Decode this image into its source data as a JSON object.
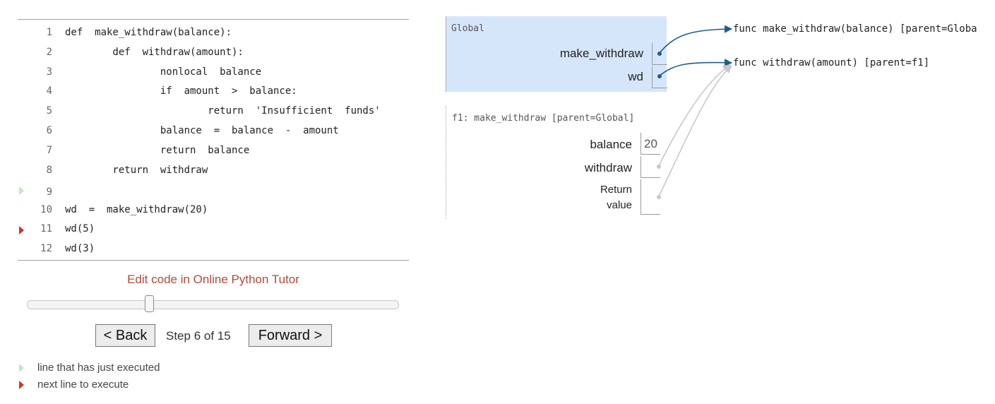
{
  "code": {
    "lines": [
      {
        "no": "1",
        "text": "def  make_withdraw(balance):",
        "marker": ""
      },
      {
        "no": "2",
        "text": "        def  withdraw(amount):",
        "marker": ""
      },
      {
        "no": "3",
        "text": "                nonlocal  balance",
        "marker": ""
      },
      {
        "no": "4",
        "text": "                if  amount  >  balance:",
        "marker": ""
      },
      {
        "no": "5",
        "text": "                        return  'Insufficient  funds'",
        "marker": ""
      },
      {
        "no": "6",
        "text": "                balance  =  balance  -  amount",
        "marker": ""
      },
      {
        "no": "7",
        "text": "                return  balance",
        "marker": ""
      },
      {
        "no": "8",
        "text": "        return  withdraw",
        "marker": ""
      },
      {
        "no": "9",
        "text": "",
        "marker": "green"
      },
      {
        "no": "10",
        "text": "wd  =  make_withdraw(20)",
        "marker": ""
      },
      {
        "no": "11",
        "text": "wd(5)",
        "marker": "red"
      },
      {
        "no": "12",
        "text": "wd(3)",
        "marker": ""
      }
    ]
  },
  "controls": {
    "edit_link": "Edit code in Online Python Tutor",
    "back_label": "< Back",
    "forward_label": "Forward >",
    "step_text": "Step 6 of 15",
    "step_current": 6,
    "step_total": 15,
    "slider_fraction": 0.33
  },
  "legend": {
    "just_executed": "line that has just executed",
    "next_line": "next line to execute"
  },
  "frames": {
    "global": {
      "title": "Global",
      "vars": [
        {
          "name": "make_withdraw"
        },
        {
          "name": "wd"
        }
      ]
    },
    "f1": {
      "title": "f1: make_withdraw [parent=Global]",
      "vars": [
        {
          "name": "balance",
          "value": "20"
        },
        {
          "name": "withdraw",
          "value": ""
        },
        {
          "name": "Return",
          "name2": "value",
          "value": ""
        }
      ]
    }
  },
  "heap": {
    "objects": [
      {
        "label": "func make_withdraw(balance) [parent=Globa"
      },
      {
        "label": "func withdraw(amount) [parent=f1]"
      }
    ]
  },
  "colors": {
    "pointer_active": "#1f5f8b",
    "pointer_inactive": "#c8c8c8",
    "frame_active_bg": "#d6e6fa",
    "link": "#b04a38",
    "arrow_green": "#c2e7c2",
    "arrow_red": "#d9302c"
  }
}
